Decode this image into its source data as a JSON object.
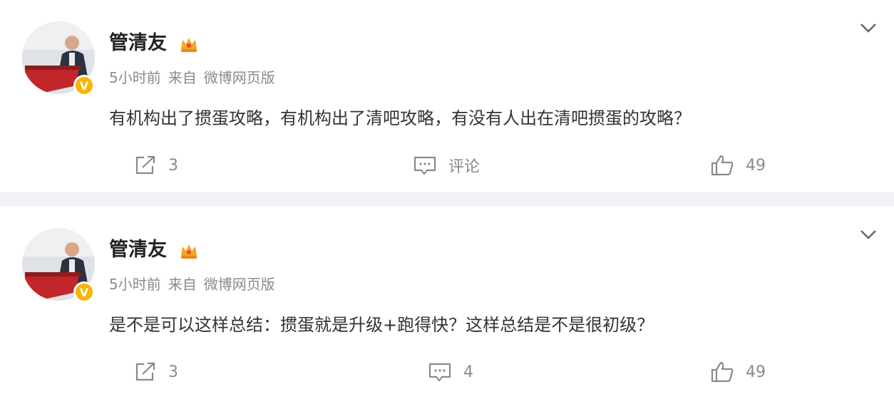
{
  "colors": {
    "page_bg": "#f1f2f5",
    "card_bg": "#ffffff",
    "text_main": "#333333",
    "text_meta": "#8a8a8a",
    "verified": "#f7b500"
  },
  "posts": [
    {
      "author": "管清友",
      "meta": {
        "time": "5小时前",
        "source_prefix": "来自",
        "source": "微博网页版"
      },
      "text": "有机构出了掼蛋攻略，有机构出了清吧攻略，有没有人出在清吧掼蛋的攻略？",
      "actions": {
        "repost": "3",
        "comment": "评论",
        "like": "49"
      },
      "icons": [
        "avatar-photo",
        "verified-v-icon",
        "crown-badge-icon",
        "chevron-down-icon",
        "repost-icon",
        "comment-icon",
        "like-icon"
      ]
    },
    {
      "author": "管清友",
      "meta": {
        "time": "5小时前",
        "source_prefix": "来自",
        "source": "微博网页版"
      },
      "text": "是不是可以这样总结：掼蛋就是升级+跑得快？这样总结是不是很初级？",
      "actions": {
        "repost": "3",
        "comment": "4",
        "like": "49"
      },
      "icons": [
        "avatar-photo",
        "verified-v-icon",
        "crown-badge-icon",
        "chevron-down-icon",
        "repost-icon",
        "comment-icon",
        "like-icon"
      ]
    }
  ]
}
